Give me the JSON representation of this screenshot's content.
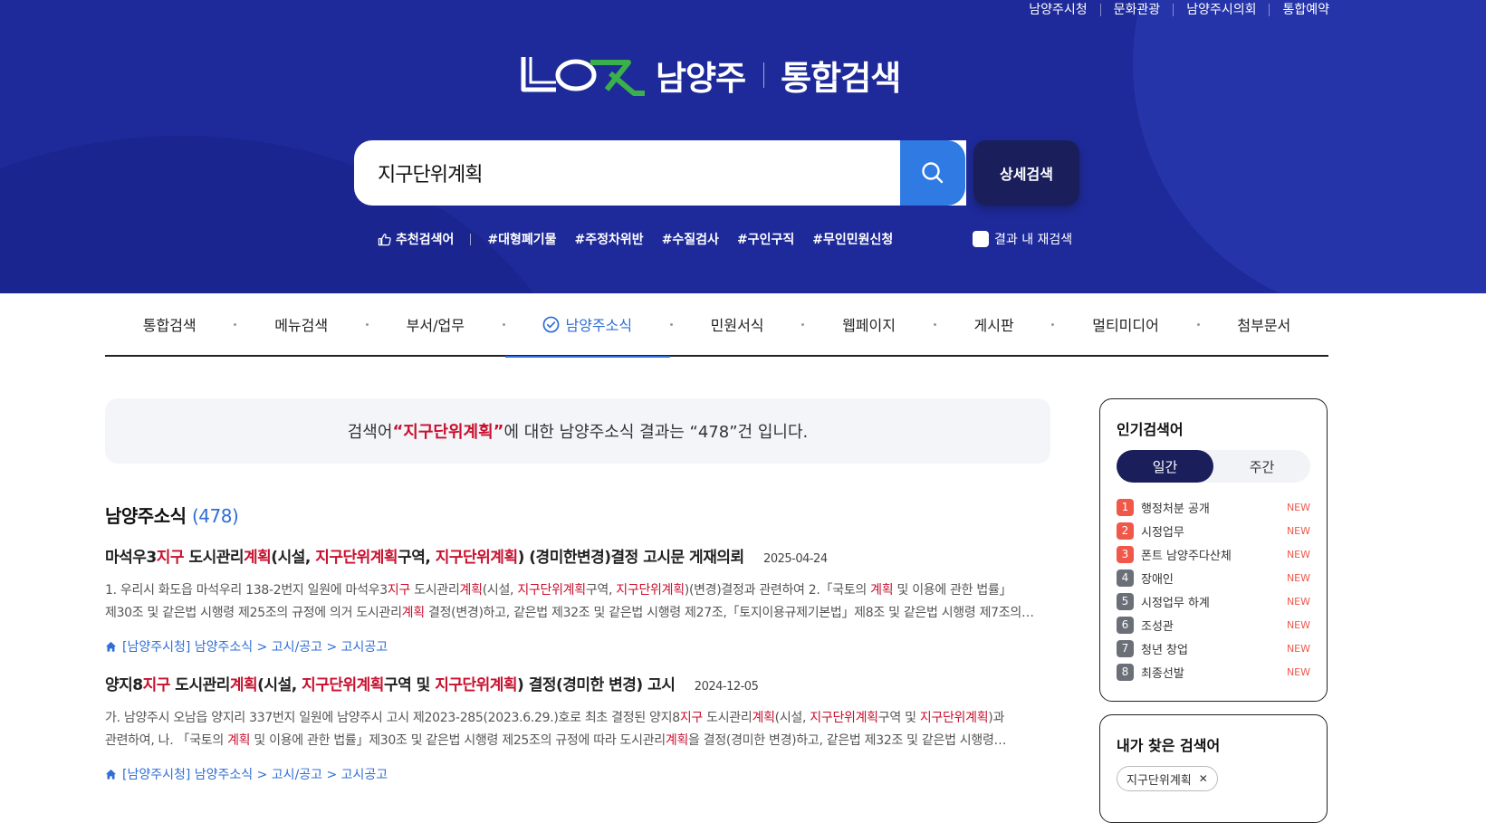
{
  "util_links": [
    "남양주시청",
    "문화관광",
    "남양주시의회",
    "통합예약"
  ],
  "logo": {
    "brand": "남양주",
    "title": "통합검색"
  },
  "search": {
    "value": "지구단위계획",
    "detail_label": "상세검색"
  },
  "recommend": {
    "label": "추천검색어",
    "tags": [
      "#대형폐기물",
      "#주정차위반",
      "#수질검사",
      "#구인구직",
      "#무인민원신청"
    ],
    "research_label": "결과 내 재검색"
  },
  "tabs": [
    "통합검색",
    "메뉴검색",
    "부서/업무",
    "남양주소식",
    "민원서식",
    "웹페이지",
    "게시판",
    "멀티미디어",
    "첨부문서"
  ],
  "summary": {
    "prefix": "검색어 ",
    "open_quote": "“",
    "keyword": "지구단위계획 ",
    "close_quote": "”",
    "middle": "에 대한 남양주소식 결과는 “478”건 입니다."
  },
  "section": {
    "title": "남양주소식",
    "count": "(478)"
  },
  "results": [
    {
      "title_parts": [
        "마석우3",
        "지구",
        " 도시관리",
        "계획",
        "(시설, ",
        "지구단위계획",
        "구역, ",
        "지구단위계획",
        ") (경미한변경)결정 고시문 게재의뢰"
      ],
      "date": "2025-04-24",
      "desc1_parts": [
        "1. 우리시 화도읍 마석우리 138-2번지 일원에 마석우3",
        "지구",
        " 도시관리",
        "계획",
        "(시설, ",
        "지구단위계획",
        "구역, ",
        "지구단위계획",
        ")(변경)결정과 관련하여 2.「국토의 ",
        "계획",
        " 및 이용에 관한 법률」"
      ],
      "desc2_parts": [
        "제30조 및 같은법 시행령 제25조의 규정에 의거 도시관리",
        "계획",
        " 결정(변경)하고, 같은법 제32조 및 같은법 시행령 제27조,「토지이용규제기본법」제8조 및 같은법 시행령 제7조의…"
      ],
      "path": "[남양주시청] 남양주소식 > 고시/공고 > 고시공고"
    },
    {
      "title_parts": [
        "양지8",
        "지구",
        " 도시관리",
        "계획",
        "(시설, ",
        "지구단위계획",
        "구역 및 ",
        "지구단위계획",
        ") 결정(경미한 변경) 고시"
      ],
      "date": "2024-12-05",
      "desc1_parts": [
        "가. 남양주시 오남읍 양지리 337번지 일원에 남양주시 고시 제2023-285(2023.6.29.)호로 최초 결정된 양지8",
        "지구",
        " 도시관리",
        "계획",
        "(시설, ",
        "지구단위계획",
        "구역 및 ",
        "지구단위계획",
        ")과"
      ],
      "desc2_parts": [
        "관련하여, 나. 「국토의 ",
        "계획",
        " 및 이용에 관한 법률」제30조 및 같은법 시행령 제25조의 규정에 따라 도시관리",
        "계획",
        "을 결정(경미한 변경)하고, 같은법 제32조 및 같은법 시행령…"
      ],
      "path": "[남양주시청] 남양주소식 > 고시/공고 > 고시공고"
    }
  ],
  "popular": {
    "title": "인기검색어",
    "seg": [
      "일간",
      "주간"
    ],
    "items": [
      {
        "rank": "1",
        "keyword": "행정처분 공개",
        "badge": "NEW"
      },
      {
        "rank": "2",
        "keyword": "시정업무",
        "badge": "NEW"
      },
      {
        "rank": "3",
        "keyword": "폰트 남양주다산체",
        "badge": "NEW"
      },
      {
        "rank": "4",
        "keyword": "장애인",
        "badge": "NEW"
      },
      {
        "rank": "5",
        "keyword": "시정업무 하계",
        "badge": "NEW"
      },
      {
        "rank": "6",
        "keyword": "조성관",
        "badge": "NEW"
      },
      {
        "rank": "7",
        "keyword": "청년 창업",
        "badge": "NEW"
      },
      {
        "rank": "8",
        "keyword": "최종선발",
        "badge": "NEW"
      }
    ]
  },
  "my_searches": {
    "title": "내가 찾은 검색어",
    "items": [
      "지구단위계획"
    ]
  },
  "colors": {
    "hero": "#1e2a99",
    "accent_blue": "#2f7ae3",
    "highlight_red": "#c8102e",
    "dark_navy": "#1a1f5c"
  }
}
